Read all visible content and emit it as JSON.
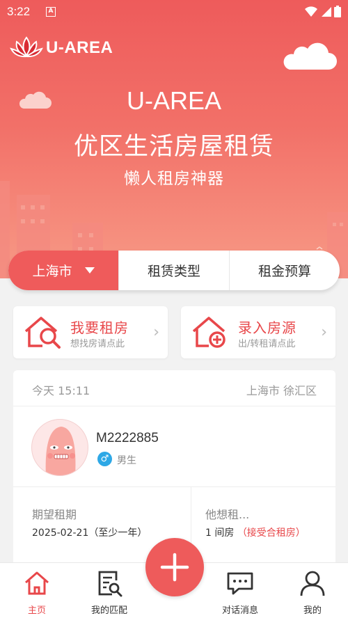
{
  "status": {
    "time": "3:22",
    "notification_badge": "A"
  },
  "brand": {
    "logo_text": "U-AREA"
  },
  "hero": {
    "title": "U-AREA",
    "subtitle": "优区生活房屋租赁",
    "tagline": "懒人租房神器"
  },
  "filters": {
    "city": "上海市",
    "type": "租赁类型",
    "budget": "租金预算"
  },
  "actions": [
    {
      "title": "我要租房",
      "subtitle": "想找房请点此",
      "icon": "house-search-icon"
    },
    {
      "title": "录入房源",
      "subtitle": "出/转租请点此",
      "icon": "house-add-icon"
    }
  ],
  "listing": {
    "time": "今天 15:11",
    "location": "上海市 徐汇区",
    "username": "M2222885",
    "gender_symbol": "♂",
    "gender": "男生",
    "period_label": "期望租期",
    "period_value": "2025-02-21（至少一年）",
    "want_label": "他想租...",
    "want_value": "1 间房",
    "want_note": "（接受合租房）"
  },
  "nav": [
    {
      "label": "主页",
      "icon": "home-icon",
      "active": true
    },
    {
      "label": "我的匹配",
      "icon": "match-search-icon",
      "active": false
    },
    {
      "label": "对话消息",
      "icon": "chat-icon",
      "active": false
    },
    {
      "label": "我的",
      "icon": "user-icon",
      "active": false
    }
  ],
  "colors": {
    "primary": "#ee5b5b",
    "accent": "#e8474a",
    "male": "#2ea8e6"
  }
}
